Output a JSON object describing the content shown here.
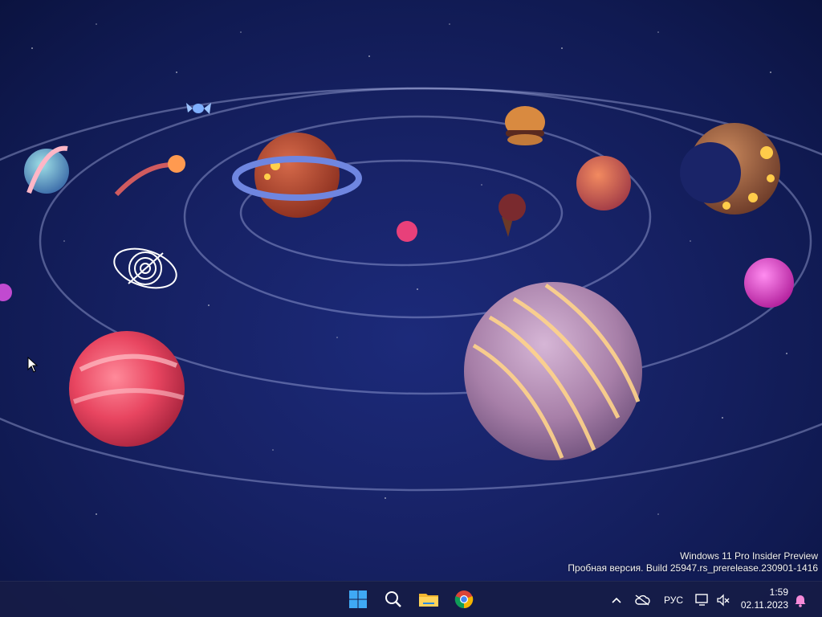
{
  "wallpaper": {
    "theme": "candy-solar-system",
    "background_color": "#172266"
  },
  "watermark": {
    "line1": "Windows 11 Pro Insider Preview",
    "line2": "Пробная версия. Build 25947.rs_prerelease.230901-1416"
  },
  "taskbar": {
    "pinned": [
      {
        "name": "start",
        "icon": "windows-logo-icon"
      },
      {
        "name": "search",
        "icon": "search-icon"
      },
      {
        "name": "file-explorer",
        "icon": "folder-icon"
      },
      {
        "name": "chrome",
        "icon": "chrome-icon"
      }
    ],
    "tray": {
      "overflow_icon": "chevron-up-icon",
      "network_icon": "cloud-offline-icon",
      "language": "РУС",
      "display_icon": "monitor-icon",
      "volume_icon": "volume-muted-icon",
      "notification_icon": "bell-icon"
    },
    "clock": {
      "time": "1:59",
      "date": "02.11.2023"
    }
  }
}
